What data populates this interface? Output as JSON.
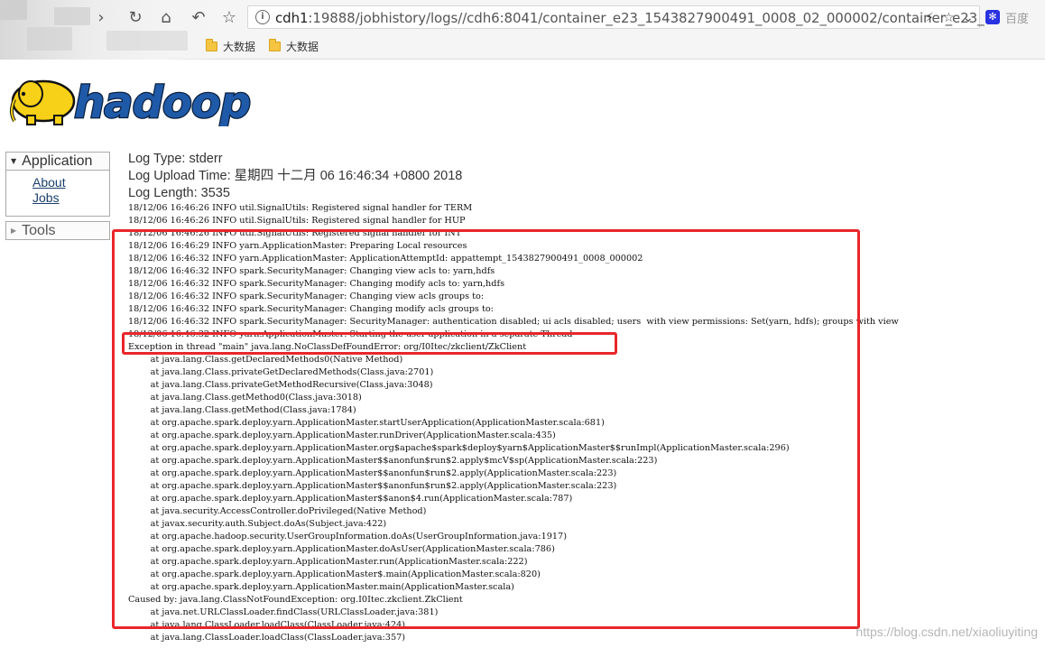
{
  "browser": {
    "url_host": "cdh1",
    "url_path": ":19888/jobhistory/logs//cdh6:8041/container_e23_1543827900491_0008_02_000002/container_e23_...",
    "search_engine": "百度",
    "bookmarks": [
      "大数据",
      "大数据"
    ]
  },
  "logo": {
    "text": "hadoop"
  },
  "sidebar": {
    "application": {
      "label": "Application",
      "links": [
        "About",
        "Jobs"
      ]
    },
    "tools": {
      "label": "Tools"
    }
  },
  "log_meta": {
    "log_type": "Log Type: stderr",
    "log_upload_time": "Log Upload Time: 星期四 十二月 06 16:46:34 +0800 2018",
    "log_length": "Log Length: 3535"
  },
  "log_lines": [
    "18/12/06 16:46:26 INFO util.SignalUtils: Registered signal handler for TERM",
    "18/12/06 16:46:26 INFO util.SignalUtils: Registered signal handler for HUP",
    "18/12/06 16:46:26 INFO util.SignalUtils: Registered signal handler for INT",
    "18/12/06 16:46:29 INFO yarn.ApplicationMaster: Preparing Local resources",
    "18/12/06 16:46:32 INFO yarn.ApplicationMaster: ApplicationAttemptId: appattempt_1543827900491_0008_000002",
    "18/12/06 16:46:32 INFO spark.SecurityManager: Changing view acls to: yarn,hdfs",
    "18/12/06 16:46:32 INFO spark.SecurityManager: Changing modify acls to: yarn,hdfs",
    "18/12/06 16:46:32 INFO spark.SecurityManager: Changing view acls groups to:",
    "18/12/06 16:46:32 INFO spark.SecurityManager: Changing modify acls groups to:",
    "18/12/06 16:46:32 INFO spark.SecurityManager: SecurityManager: authentication disabled; ui acls disabled; users  with view permissions: Set(yarn, hdfs); groups with view",
    "18/12/06 16:46:32 INFO yarn.ApplicationMaster: Starting the user application in a separate Thread",
    "Exception in thread \"main\" java.lang.NoClassDefFoundError: org/I0Itec/zkclient/ZkClient",
    "        at java.lang.Class.getDeclaredMethods0(Native Method)",
    "        at java.lang.Class.privateGetDeclaredMethods(Class.java:2701)",
    "        at java.lang.Class.privateGetMethodRecursive(Class.java:3048)",
    "        at java.lang.Class.getMethod0(Class.java:3018)",
    "        at java.lang.Class.getMethod(Class.java:1784)",
    "        at org.apache.spark.deploy.yarn.ApplicationMaster.startUserApplication(ApplicationMaster.scala:681)",
    "        at org.apache.spark.deploy.yarn.ApplicationMaster.runDriver(ApplicationMaster.scala:435)",
    "        at org.apache.spark.deploy.yarn.ApplicationMaster.org$apache$spark$deploy$yarn$ApplicationMaster$$runImpl(ApplicationMaster.scala:296)",
    "        at org.apache.spark.deploy.yarn.ApplicationMaster$$anonfun$run$2.apply$mcV$sp(ApplicationMaster.scala:223)",
    "        at org.apache.spark.deploy.yarn.ApplicationMaster$$anonfun$run$2.apply(ApplicationMaster.scala:223)",
    "        at org.apache.spark.deploy.yarn.ApplicationMaster$$anonfun$run$2.apply(ApplicationMaster.scala:223)",
    "        at org.apache.spark.deploy.yarn.ApplicationMaster$$anon$4.run(ApplicationMaster.scala:787)",
    "        at java.security.AccessController.doPrivileged(Native Method)",
    "        at javax.security.auth.Subject.doAs(Subject.java:422)",
    "        at org.apache.hadoop.security.UserGroupInformation.doAs(UserGroupInformation.java:1917)",
    "        at org.apache.spark.deploy.yarn.ApplicationMaster.doAsUser(ApplicationMaster.scala:786)",
    "        at org.apache.spark.deploy.yarn.ApplicationMaster.run(ApplicationMaster.scala:222)",
    "        at org.apache.spark.deploy.yarn.ApplicationMaster$.main(ApplicationMaster.scala:820)",
    "        at org.apache.spark.deploy.yarn.ApplicationMaster.main(ApplicationMaster.scala)",
    "Caused by: java.lang.ClassNotFoundException: org.I0Itec.zkclient.ZkClient",
    "        at java.net.URLClassLoader.findClass(URLClassLoader.java:381)",
    "        at java.lang.ClassLoader.loadClass(ClassLoader.java:424)",
    "        at java.lang.ClassLoader.loadClass(ClassLoader.java:357)"
  ],
  "watermark": "https://blog.csdn.net/xiaoliuyiting",
  "colors": {
    "highlight_red": "#e8262b",
    "link_blue": "#1b3f6e",
    "logo_yellow": "#f7d117",
    "logo_blue": "#1f5aa8"
  }
}
